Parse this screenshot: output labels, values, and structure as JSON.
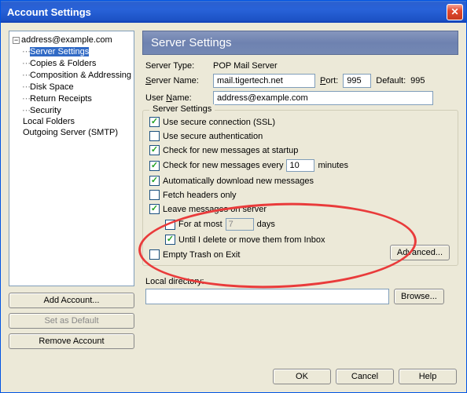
{
  "title": "Account Settings",
  "tree": {
    "account": "address@example.com",
    "items": [
      "Server Settings",
      "Copies & Folders",
      "Composition & Addressing",
      "Disk Space",
      "Return Receipts",
      "Security"
    ],
    "localFolders": "Local Folders",
    "outgoing": "Outgoing Server (SMTP)"
  },
  "leftButtons": {
    "add": "Add Account...",
    "setDefault": "Set as Default",
    "remove": "Remove Account"
  },
  "header": "Server Settings",
  "serverType": {
    "label": "Server Type:",
    "value": "POP Mail Server"
  },
  "serverName": {
    "label": "Server Name:",
    "value": "mail.tigertech.net"
  },
  "port": {
    "label": "Port:",
    "value": "995",
    "defaultLabel": "Default:",
    "defaultValue": "995"
  },
  "userName": {
    "label": "User Name:",
    "value": "address@example.com"
  },
  "fieldset": {
    "legend": "Server Settings",
    "ssl": "Use secure connection (SSL)",
    "secureAuth": "Use secure authentication",
    "checkStartup": "Check for new messages at startup",
    "checkEvery": {
      "pre": "Check for new messages every",
      "value": "10",
      "post": "minutes"
    },
    "autoDownload": "Automatically download new messages",
    "fetchHeaders": "Fetch headers only",
    "leaveOnServer": "Leave messages on server",
    "forAtMost": {
      "pre": "For at most",
      "value": "7",
      "post": "days"
    },
    "untilDelete": "Until I delete or move them from Inbox",
    "emptyTrash": "Empty Trash on Exit",
    "advanced": "Advanced..."
  },
  "localDir": {
    "label": "Local directory:",
    "value": "",
    "browse": "Browse..."
  },
  "footer": {
    "ok": "OK",
    "cancel": "Cancel",
    "help": "Help"
  }
}
